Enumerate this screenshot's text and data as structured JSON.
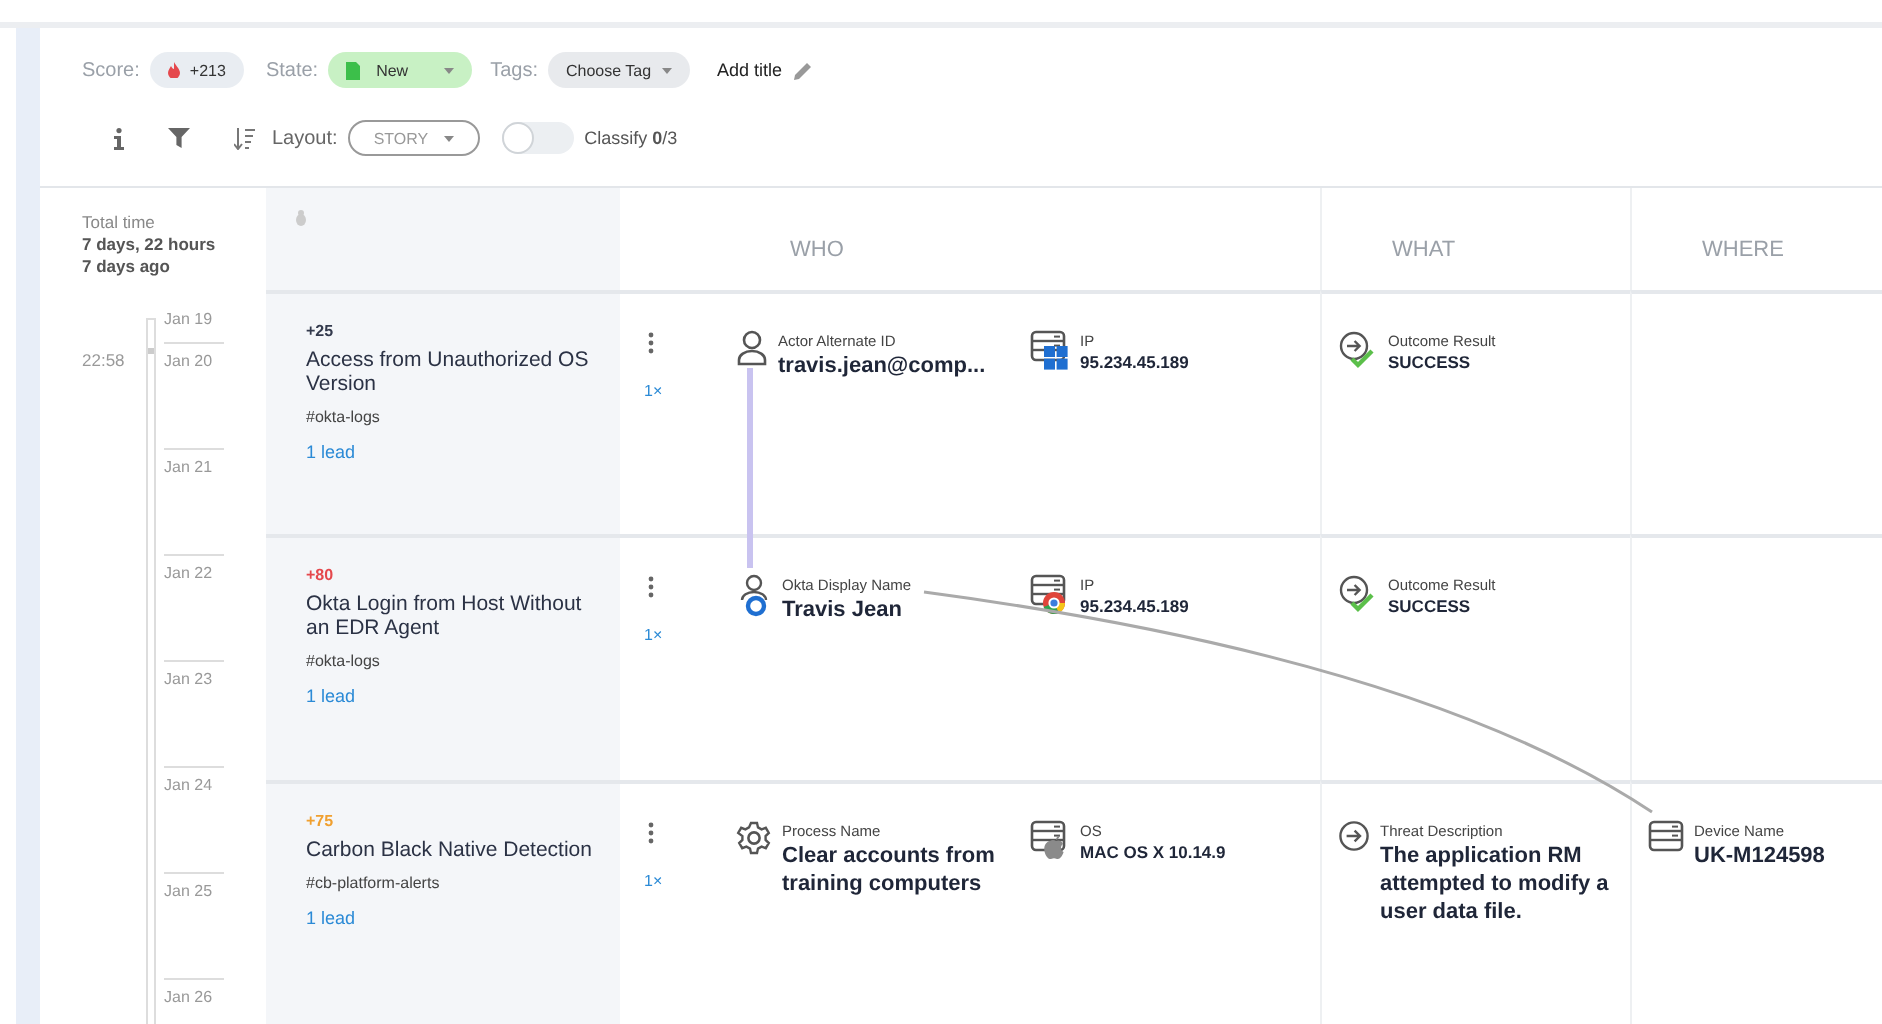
{
  "header": {
    "score_label": "Score:",
    "score": "+213",
    "state_label": "State:",
    "state": "New",
    "tags_label": "Tags:",
    "tags_placeholder": "Choose Tag",
    "title_action": "Add title"
  },
  "toolbar": {
    "layout_label": "Layout:",
    "layout": "STORY",
    "classify_on": false,
    "classify": "Classify **0**/3"
  },
  "timeline": {
    "total_label": "Total time",
    "duration": "7 days, 22 hours",
    "ago": "7 days ago",
    "time": "22:58",
    "dates": [
      "Jan 19",
      "Jan 20",
      "Jan 21",
      "Jan 22",
      "Jan 23",
      "Jan 24",
      "Jan 25",
      "Jan 26"
    ]
  },
  "columns": [
    "WHO",
    "WHAT",
    "WHERE"
  ],
  "stories": [
    {
      "score": "+25",
      "color": "#333a4d",
      "title": "Access from Unauthorized OS Version",
      "tag": "#okta-logs",
      "leads": "1 lead",
      "count": "1×",
      "who": [
        {
          "kind": "user",
          "label": "Actor Alternate ID",
          "value": "travis.jean@comp..."
        },
        {
          "kind": "host-windows",
          "label": "IP",
          "value": "95.234.45.189"
        }
      ],
      "what": [
        {
          "kind": "outcome-success",
          "label": "Outcome Result",
          "value": "SUCCESS"
        }
      ]
    },
    {
      "score": "+80",
      "color": "#e5484d",
      "title": "Okta Login from Host Without an EDR Agent",
      "tag": "#okta-logs",
      "leads": "1 lead",
      "count": "1×",
      "who": [
        {
          "kind": "user-okta",
          "label": "Okta Display Name",
          "value": "Travis Jean"
        },
        {
          "kind": "host-chrome",
          "label": "IP",
          "value": "95.234.45.189"
        }
      ],
      "what": [
        {
          "kind": "outcome-success",
          "label": "Outcome Result",
          "value": "SUCCESS"
        }
      ]
    },
    {
      "score": "+75",
      "color": "#f0a030",
      "title": "Carbon Black Native Detection",
      "tag": "#cb-platform-alerts",
      "leads": "1 lead",
      "count": "1×",
      "who": [
        {
          "kind": "process",
          "label": "Process Name",
          "value": "Clear accounts from training computers"
        },
        {
          "kind": "host-apple",
          "label": "OS",
          "value": "MAC OS X 10.14.9"
        }
      ],
      "what": [
        {
          "kind": "outcome",
          "label": "Threat Description",
          "value": "The application RM attempted to modify a user data file."
        }
      ],
      "where": [
        {
          "kind": "device",
          "label": "Device Name",
          "value": "UK-M124598"
        }
      ]
    }
  ]
}
